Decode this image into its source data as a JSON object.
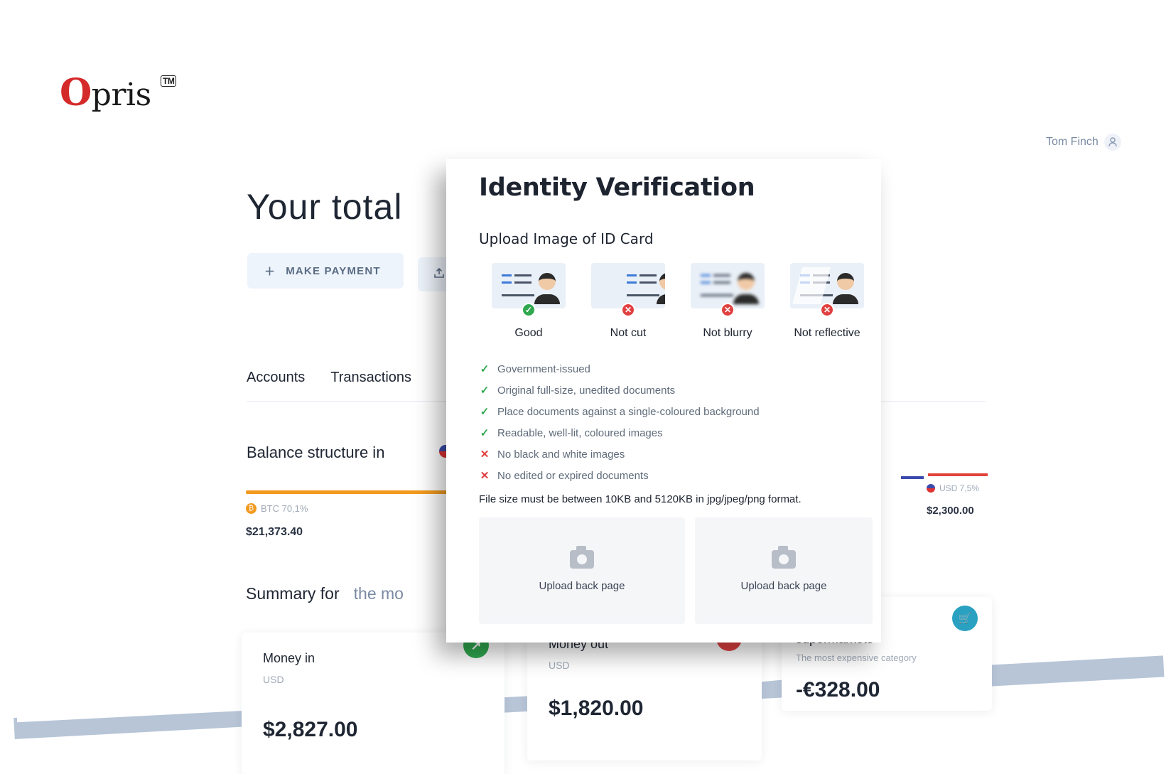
{
  "brand": {
    "name": "pris",
    "first_letter": "O",
    "tm": "TM"
  },
  "user": {
    "name": "Tom Finch"
  },
  "dashboard": {
    "title": "Your total",
    "make_payment": "Make payment",
    "tabs": [
      "Accounts",
      "Transactions"
    ],
    "balance_title": "Balance structure in",
    "btc": {
      "label": "BTC 70,1%",
      "amount": "$21,373.40"
    },
    "usd": {
      "label": "USD 7,5%",
      "amount": "$2,300.00"
    },
    "summary_label": "Summary for",
    "summary_period": "the mo",
    "cards": [
      {
        "name": "Money in",
        "currency": "USD",
        "amount": "$2,827.00",
        "badge": "↗",
        "badge_color": "#2fa84f"
      },
      {
        "name": "Money out",
        "currency": "USD",
        "amount": "$1,820.00",
        "badge": "↘",
        "badge_color": "#e14040"
      },
      {
        "name": "Products and supermarkets",
        "sub": "The most expensive category",
        "amount": "-€328.00",
        "badge": "🛒",
        "badge_color": "#2aa1c0"
      }
    ]
  },
  "modal": {
    "title": "Identity Verification",
    "subtitle": "Upload Image of ID Card",
    "samples": [
      {
        "label": "Good",
        "status": "✓"
      },
      {
        "label": "Not cut",
        "status": "✕"
      },
      {
        "label": "Not blurry",
        "status": "✕"
      },
      {
        "label": "Not reflective",
        "status": "✕"
      }
    ],
    "rules": [
      {
        "text": "Government-issued",
        "ok": true
      },
      {
        "text": "Original full-size, unedited documents",
        "ok": true
      },
      {
        "text": "Place documents against a single-coloured background",
        "ok": true
      },
      {
        "text": "Readable, well-lit, coloured images",
        "ok": true
      },
      {
        "text": "No black and white images",
        "ok": false
      },
      {
        "text": "No edited or expired documents",
        "ok": false
      }
    ],
    "rule_ok_mark": "✓",
    "rule_bad_mark": "✕",
    "file_size_note": "File size must be between 10KB and 5120KB in jpg/jpeg/png format.",
    "upload_left": "Upload back page",
    "upload_right": "Upload back page"
  },
  "colors": {
    "accent_orange": "#f29a1f",
    "success": "#2fa84f",
    "danger": "#e14040",
    "brand_red": "#d42a2a"
  }
}
